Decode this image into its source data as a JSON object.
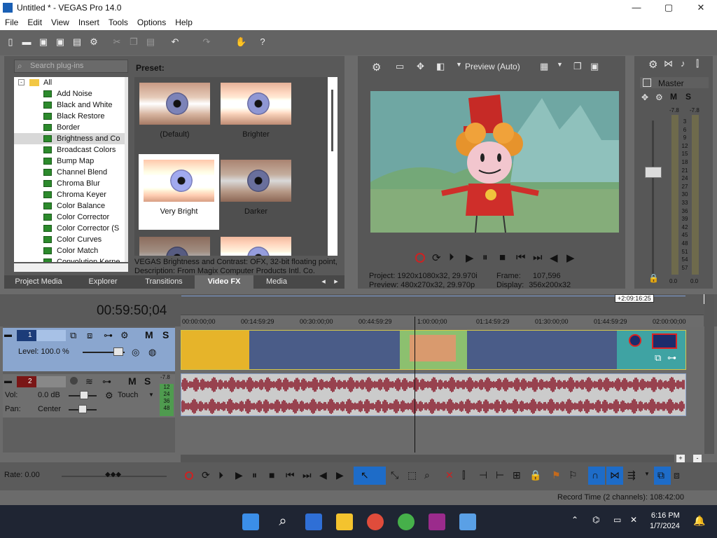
{
  "window": {
    "title": "Untitled * - VEGAS Pro 14.0",
    "minimize": "—",
    "maximize": "▢",
    "close": "✕"
  },
  "menu": [
    "File",
    "Edit",
    "View",
    "Insert",
    "Tools",
    "Options",
    "Help"
  ],
  "fx": {
    "search_placeholder": "Search plug-ins",
    "tree_root": "All",
    "plugins": [
      "Add Noise",
      "Black and White",
      "Black Restore",
      "Border",
      "Brightness and Co",
      "Broadcast Colors",
      "Bump Map",
      "Channel Blend",
      "Chroma Blur",
      "Chroma Keyer",
      "Color Balance",
      "Color Corrector",
      "Color Corrector (S",
      "Color Curves",
      "Color Match",
      "Convolution Kerne"
    ],
    "selected_plugin_index": 4,
    "preset_label": "Preset:",
    "presets": [
      "(Default)",
      "Brighter",
      "Very Bright",
      "Darker"
    ],
    "selected_preset_index": 2,
    "description_line1": "VEGAS Brightness and Contrast: OFX, 32-bit floating point, (",
    "description_line2": "Description: From Magix Computer Products Intl. Co."
  },
  "tabs": [
    "Project Media",
    "Explorer",
    "Transitions",
    "Video FX",
    "Media Generat"
  ],
  "active_tab_index": 3,
  "preview": {
    "mode": "Preview (Auto)",
    "project_label": "Project:",
    "project_value": "1920x1080x32, 29.970i",
    "preview_label": "Preview:",
    "preview_value": "480x270x32, 29.970p",
    "frame_label": "Frame:",
    "frame_value": "107,596",
    "display_label": "Display:",
    "display_value": "356x200x32"
  },
  "master": {
    "label": "Master",
    "m": "M",
    "s": "S",
    "left_peak": "-7.8",
    "right_peak": "-7.8",
    "scale": [
      "3",
      "6",
      "9",
      "12",
      "15",
      "18",
      "21",
      "24",
      "27",
      "30",
      "33",
      "36",
      "39",
      "42",
      "45",
      "48",
      "51",
      "54",
      "57"
    ],
    "left_level": "0.0",
    "right_level": "0.0"
  },
  "timeline": {
    "timecode": "00:59:50;04",
    "end_badge": "+2:09:16:25",
    "ruler_ticks": [
      "00:00:00;00",
      "00:14:59:29",
      "00:30:00;00",
      "00:44:59:29",
      "1:00:00;00",
      "01:14:59:29",
      "01:30:00;00",
      "01:44:59:29",
      "02:00:00;00"
    ],
    "video_track": {
      "number": "1",
      "level_label": "Level: 100.0 %",
      "m": "M",
      "s": "S"
    },
    "audio_track": {
      "number": "2",
      "vol_label": "Vol:",
      "vol_value": "0.0 dB",
      "pan_label": "Pan:",
      "pan_value": "Center",
      "touch_label": "Touch",
      "m": "M",
      "s": "S",
      "peak": "-7.8",
      "scale": [
        "12",
        "24",
        "36",
        "48"
      ]
    },
    "rate": "Rate: 0.00"
  },
  "status": {
    "record_time": "Record Time (2 channels): 108:42:00"
  },
  "clock": {
    "time": "6:16 PM",
    "date": "1/7/2024"
  },
  "colors": {
    "accent": "#1e6cc8",
    "video_track": "#4a5c88",
    "audio_wave": "#8c2030",
    "clip_yellow": "#e6b42a",
    "clip_teal": "#3fa3a3"
  }
}
